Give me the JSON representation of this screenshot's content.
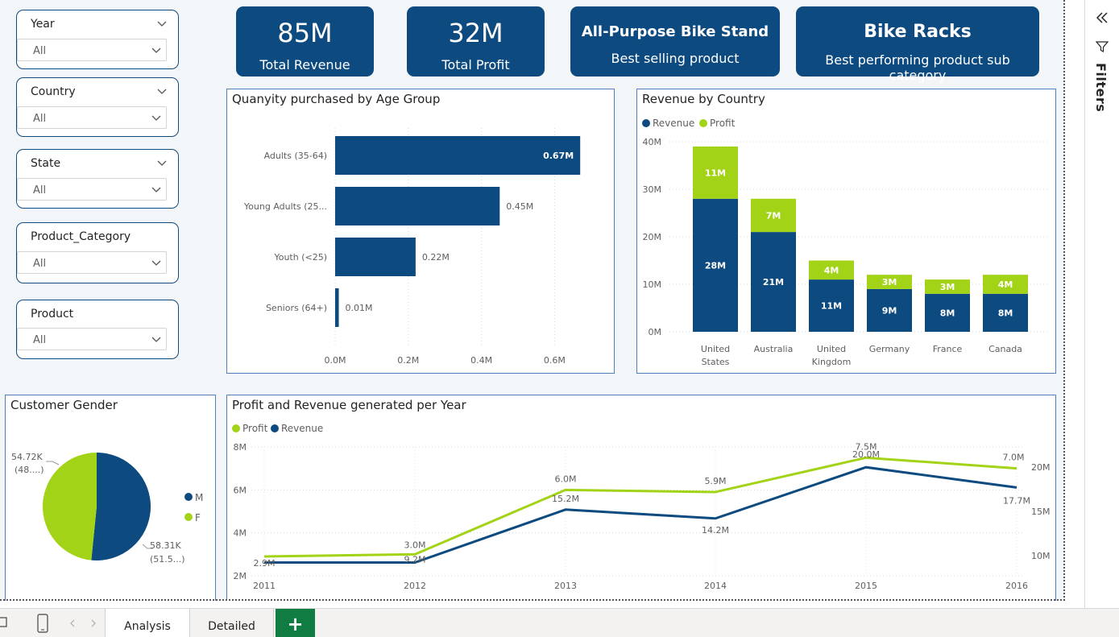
{
  "slicers": [
    {
      "title": "Year",
      "value": "All"
    },
    {
      "title": "Country",
      "value": "All"
    },
    {
      "title": "State",
      "value": "All"
    },
    {
      "title": "Product_Category",
      "value": "All"
    },
    {
      "title": "Product",
      "value": "All"
    }
  ],
  "kpis": {
    "revenue": {
      "value": "85M",
      "label": "Total Revenue"
    },
    "profit": {
      "value": "32M",
      "label": "Total Profit"
    },
    "best_product": {
      "value": "All-Purpose Bike Stand",
      "label": "Best selling product"
    },
    "best_subcat": {
      "value": "Bike Racks",
      "label": "Best performing product sub category"
    }
  },
  "colors": {
    "revenue": "#0d4a7f",
    "profit": "#a3d316",
    "accent": "#107c41"
  },
  "chart_data": [
    {
      "type": "bar",
      "orientation": "horizontal",
      "title": "Quanyity purchased by Age Group",
      "categories": [
        "Adults (35-64)",
        "Young Adults (25...",
        "Youth (<25)",
        "Seniors (64+)"
      ],
      "values": [
        0.67,
        0.45,
        0.22,
        0.01
      ],
      "data_labels": [
        "0.67M",
        "0.45M",
        "0.22M",
        "0.01M"
      ],
      "x_ticks": [
        "0.0M",
        "0.2M",
        "0.4M",
        "0.6M"
      ],
      "xlim": [
        0,
        0.7
      ]
    },
    {
      "type": "bar",
      "stacked": true,
      "title": "Revenue by Country",
      "legend": [
        "Revenue",
        "Profit"
      ],
      "categories": [
        "United States",
        "Australia",
        "United Kingdom",
        "Germany",
        "France",
        "Canada"
      ],
      "category_lines": [
        [
          "United",
          "States"
        ],
        [
          "Australia"
        ],
        [
          "United",
          "Kingdom"
        ],
        [
          "Germany"
        ],
        [
          "France"
        ],
        [
          "Canada"
        ]
      ],
      "series": [
        {
          "name": "Revenue",
          "values": [
            28,
            21,
            11,
            9,
            8,
            8
          ],
          "labels": [
            "28M",
            "21M",
            "11M",
            "9M",
            "8M",
            "8M"
          ]
        },
        {
          "name": "Profit",
          "values": [
            11,
            7,
            4,
            3,
            3,
            4
          ],
          "labels": [
            "11M",
            "7M",
            "4M",
            "3M",
            "3M",
            "4M"
          ]
        }
      ],
      "y_ticks": [
        "0M",
        "10M",
        "20M",
        "30M",
        "40M"
      ],
      "ylim": [
        0,
        40
      ]
    },
    {
      "type": "pie",
      "title": "Customer Gender",
      "legend": [
        "M",
        "F"
      ],
      "slices": [
        {
          "name": "M",
          "value": 58.31,
          "label1": "58.31K",
          "label2": "(51.5...)"
        },
        {
          "name": "F",
          "value": 54.72,
          "label1": "54.72K",
          "label2": "(48....)"
        }
      ]
    },
    {
      "type": "line",
      "title": "Profit and Revenue generated per Year",
      "legend": [
        "Profit",
        "Revenue"
      ],
      "x": [
        "2011",
        "2012",
        "2013",
        "2014",
        "2015",
        "2016"
      ],
      "series": [
        {
          "name": "Profit",
          "axis": "left",
          "values": [
            2.9,
            3.0,
            6.0,
            5.9,
            7.5,
            7.0
          ],
          "labels": [
            "2.9M",
            "3.0M",
            "6.0M",
            "5.9M",
            "7.5M",
            "7.0M"
          ]
        },
        {
          "name": "Revenue",
          "axis": "right",
          "values": [
            9.2,
            9.2,
            15.2,
            14.2,
            20.0,
            17.7
          ],
          "labels": [
            "",
            "9.2M",
            "15.2M",
            "14.2M",
            "20.0M",
            "17.7M"
          ]
        }
      ],
      "y_left_ticks": [
        "2M",
        "4M",
        "6M",
        "8M"
      ],
      "y_left_lim": [
        2,
        8
      ],
      "y_right_ticks": [
        "10M",
        "15M",
        "20M"
      ],
      "y_right_lim": [
        7.7,
        22.3
      ]
    }
  ],
  "filters_pane": {
    "label": "Filters"
  },
  "tabs": {
    "analysis": "Analysis",
    "detailed": "Detailed",
    "add": "+"
  }
}
